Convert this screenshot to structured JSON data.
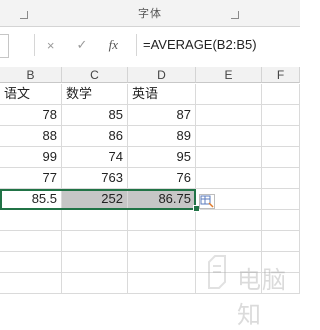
{
  "ribbon": {
    "group_label": "字体"
  },
  "formula_bar": {
    "cancel_icon": "×",
    "enter_icon": "✓",
    "fx_label": "fx",
    "formula": "=AVERAGE(B2:B5)"
  },
  "columns": [
    "B",
    "C",
    "D",
    "E",
    "F"
  ],
  "headers_row": [
    "语文",
    "数学",
    "英语"
  ],
  "rows": [
    [
      "78",
      "85",
      "87"
    ],
    [
      "88",
      "86",
      "89"
    ],
    [
      "99",
      "74",
      "95"
    ],
    [
      "77",
      "763",
      "76"
    ]
  ],
  "average_row": [
    "85.5",
    "252",
    "86.75"
  ],
  "watermark": {
    "text": "电脑知"
  },
  "colors": {
    "selection": "#217346",
    "highlight": "#c6c6c6"
  }
}
